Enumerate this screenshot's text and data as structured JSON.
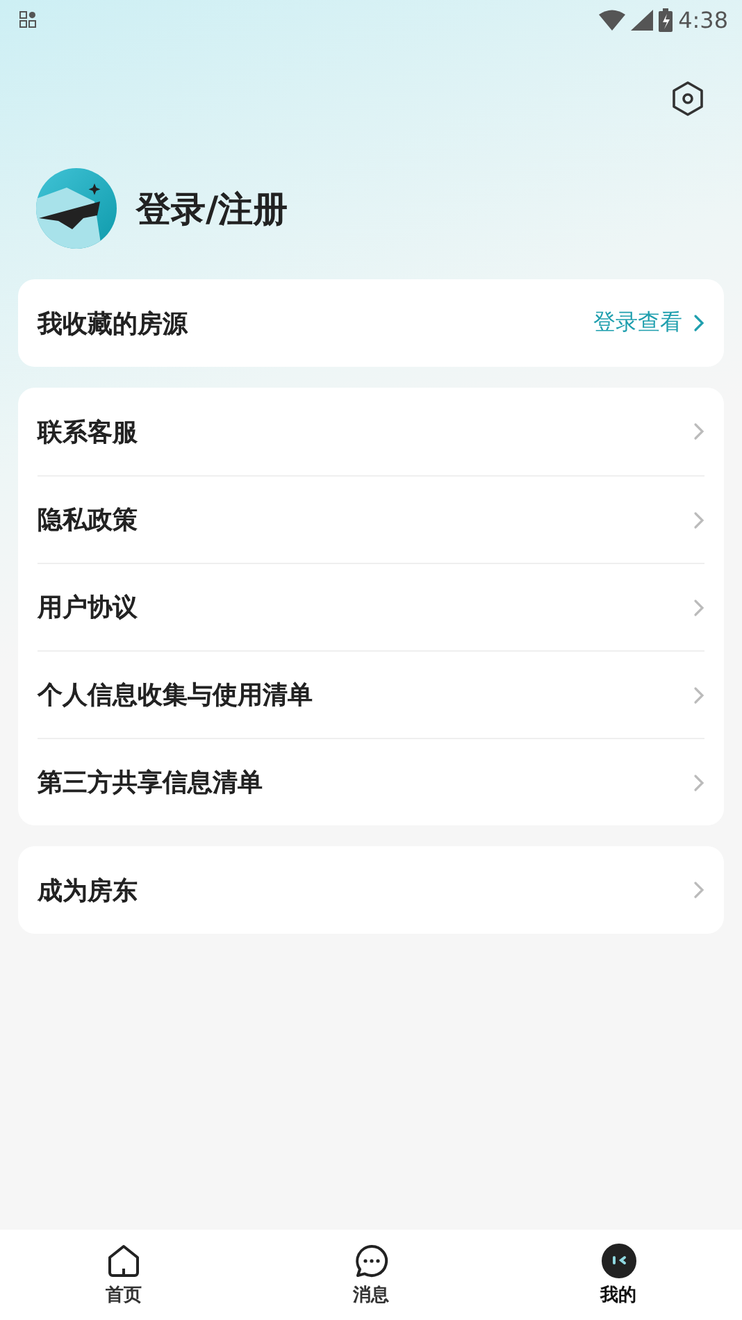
{
  "status_bar": {
    "time": "4:38"
  },
  "profile": {
    "name": "登录/注册"
  },
  "favorites": {
    "label": "我收藏的房源",
    "action": "登录查看"
  },
  "menu": [
    {
      "label": "联系客服"
    },
    {
      "label": "隐私政策"
    },
    {
      "label": "用户协议"
    },
    {
      "label": "个人信息收集与使用清单"
    },
    {
      "label": "第三方共享信息清单"
    }
  ],
  "landlord": {
    "label": "成为房东"
  },
  "tab_bar": [
    {
      "label": "首页",
      "kind": "home",
      "selected": false
    },
    {
      "label": "消息",
      "kind": "chat",
      "selected": false
    },
    {
      "label": "我的",
      "kind": "me",
      "selected": true
    }
  ]
}
